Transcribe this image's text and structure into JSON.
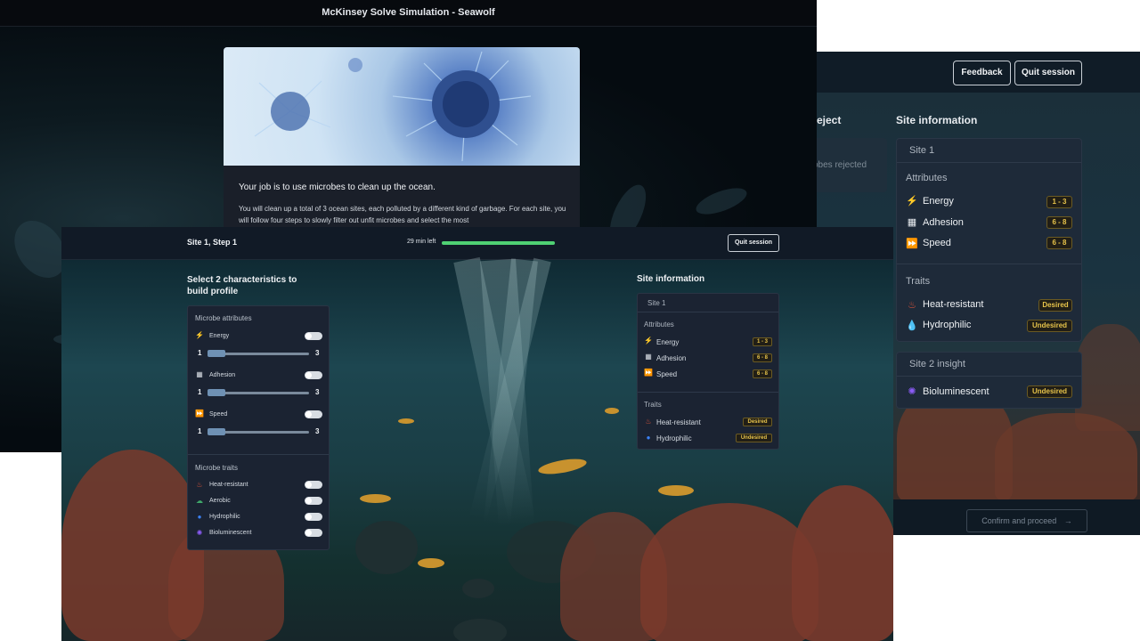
{
  "left_window": {
    "title": "McKinsey Solve Simulation - Seawolf",
    "intro_heading": "Your job is to use microbes to clean up the ocean.",
    "intro_body": "You will clean up a total of 3 ocean sites, each polluted by a different kind of garbage. For each site, you will follow four steps to slowly filter out unfit microbes and select the most"
  },
  "right_window": {
    "feedback_label": "Feedback",
    "quit_label": "Quit session",
    "reject_title": "eject",
    "reject_text": "obes rejected",
    "site_info_title": "Site information",
    "site_label": "Site 1",
    "attributes_label": "Attributes",
    "attributes": [
      {
        "name": "Energy",
        "range": "1 - 3",
        "icon": "bolt-icon"
      },
      {
        "name": "Adhesion",
        "range": "6 - 8",
        "icon": "grid-icon"
      },
      {
        "name": "Speed",
        "range": "6 - 8",
        "icon": "fast-forward-icon"
      }
    ],
    "traits_label": "Traits",
    "traits": [
      {
        "name": "Heat-resistant",
        "status": "Desired",
        "icon": "flame-icon",
        "color": "#e0553a"
      },
      {
        "name": "Hydrophilic",
        "status": "Undesired",
        "icon": "droplet-icon",
        "color": "#3b82f6"
      }
    ],
    "insight_label": "Site 2 insight",
    "insight_trait": {
      "name": "Bioluminescent",
      "status": "Undesired",
      "icon": "glow-icon",
      "color": "#8b5cf6"
    },
    "confirm_label": "Confirm and proceed",
    "confirm_arrow": "→"
  },
  "front_window": {
    "title": "Site 1, Step 1",
    "timer_text": "29 min left",
    "timer_progress": 1.0,
    "timer_color": "#4fd173",
    "quit_label": "Quit session",
    "select_title": "Select 2 characteristics to build profile",
    "attributes_label": "Microbe attributes",
    "attributes": [
      {
        "name": "Energy",
        "icon": "bolt-icon",
        "min": "1",
        "max": "3"
      },
      {
        "name": "Adhesion",
        "icon": "grid-icon",
        "min": "1",
        "max": "3"
      },
      {
        "name": "Speed",
        "icon": "fast-forward-icon",
        "min": "1",
        "max": "3"
      }
    ],
    "traits_label": "Microbe traits",
    "traits": [
      {
        "name": "Heat-resistant",
        "icon": "flame-icon",
        "color": "#e0553a"
      },
      {
        "name": "Aerobic",
        "icon": "cloud-icon",
        "color": "#3fa86a"
      },
      {
        "name": "Hydrophilic",
        "icon": "droplet-icon",
        "color": "#3b82f6"
      },
      {
        "name": "Bioluminescent",
        "icon": "glow-icon",
        "color": "#8b5cf6"
      }
    ],
    "site_info_title": "Site information",
    "site_label": "Site 1",
    "site_attributes_label": "Attributes",
    "site_attributes": [
      {
        "name": "Energy",
        "range": "1 - 3",
        "icon": "bolt-icon"
      },
      {
        "name": "Adhesion",
        "range": "6 - 8",
        "icon": "grid-icon"
      },
      {
        "name": "Speed",
        "range": "6 - 8",
        "icon": "fast-forward-icon"
      }
    ],
    "site_traits_label": "Traits",
    "site_traits": [
      {
        "name": "Heat-resistant",
        "status": "Desired",
        "icon": "flame-icon",
        "color": "#e0553a"
      },
      {
        "name": "Hydrophilic",
        "status": "Undesired",
        "icon": "droplet-icon",
        "color": "#3b82f6"
      }
    ]
  }
}
